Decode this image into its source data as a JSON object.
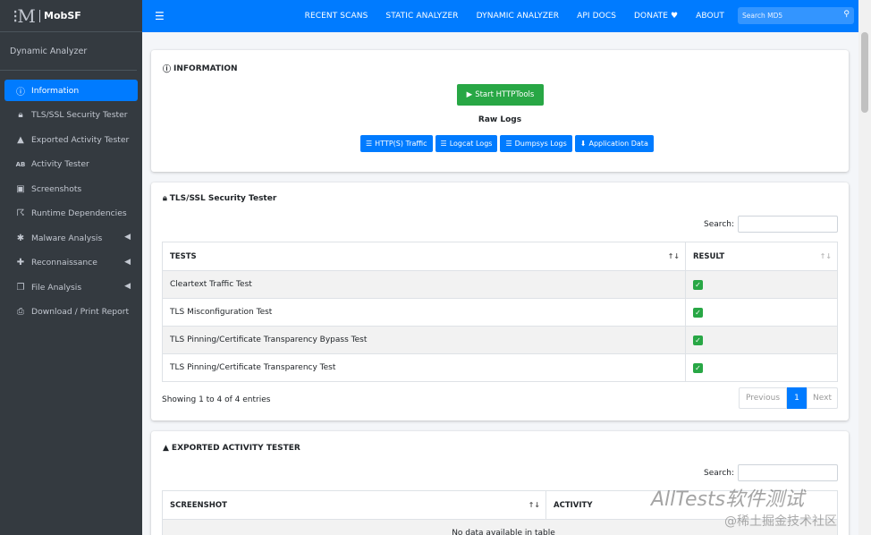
{
  "brand": {
    "text": "MobSF"
  },
  "sidebar": {
    "section_title": "Dynamic Analyzer",
    "items": [
      {
        "label": "Information",
        "icon": "info-circle-icon",
        "active": true
      },
      {
        "label": "TLS/SSL Security Tester",
        "icon": "lock-icon"
      },
      {
        "label": "Exported Activity Tester",
        "icon": "shapes-icon"
      },
      {
        "label": "Activity Tester",
        "icon": "ab-icon"
      },
      {
        "label": "Screenshots",
        "icon": "images-icon"
      },
      {
        "label": "Runtime Dependencies",
        "icon": "running-icon"
      },
      {
        "label": "Malware Analysis",
        "icon": "bug-icon",
        "arrow": true
      },
      {
        "label": "Reconnaissance",
        "icon": "plus-icon",
        "arrow": true
      },
      {
        "label": "File Analysis",
        "icon": "copy-icon",
        "arrow": true
      },
      {
        "label": "Download / Print Report",
        "icon": "print-icon"
      }
    ]
  },
  "topnav": {
    "items": [
      "RECENT SCANS",
      "STATIC ANALYZER",
      "DYNAMIC ANALYZER",
      "API DOCS",
      "DONATE ♥",
      "ABOUT"
    ],
    "search_placeholder": "Search MD5"
  },
  "information": {
    "title": "INFORMATION",
    "start_button": "Start HTTPTools",
    "raw_logs_label": "Raw Logs",
    "log_buttons": [
      "HTTP(S) Traffic",
      "Logcat Logs",
      "Dumpsys Logs",
      "Application Data"
    ]
  },
  "tls": {
    "title": "TLS/SSL Security Tester",
    "search_label": "Search:",
    "columns": [
      "TESTS",
      "RESULT"
    ],
    "rows": [
      "Cleartext Traffic Test",
      "TLS Misconfiguration Test",
      "TLS Pinning/Certificate Transparency Bypass Test",
      "TLS Pinning/Certificate Transparency Test"
    ],
    "info": "Showing 1 to 4 of 4 entries",
    "pager": {
      "prev": "Previous",
      "current": "1",
      "next": "Next"
    }
  },
  "exported": {
    "title": "EXPORTED ACTIVITY TESTER",
    "search_label": "Search:",
    "columns": [
      "SCREENSHOT",
      "ACTIVITY"
    ],
    "empty": "No data available in table"
  },
  "watermark": {
    "line1": "AllTests软件测试",
    "line2": "@稀土掘金技术社区"
  },
  "colors": {
    "primary": "#007bff",
    "success": "#28a745",
    "sidebar": "#343a40"
  }
}
